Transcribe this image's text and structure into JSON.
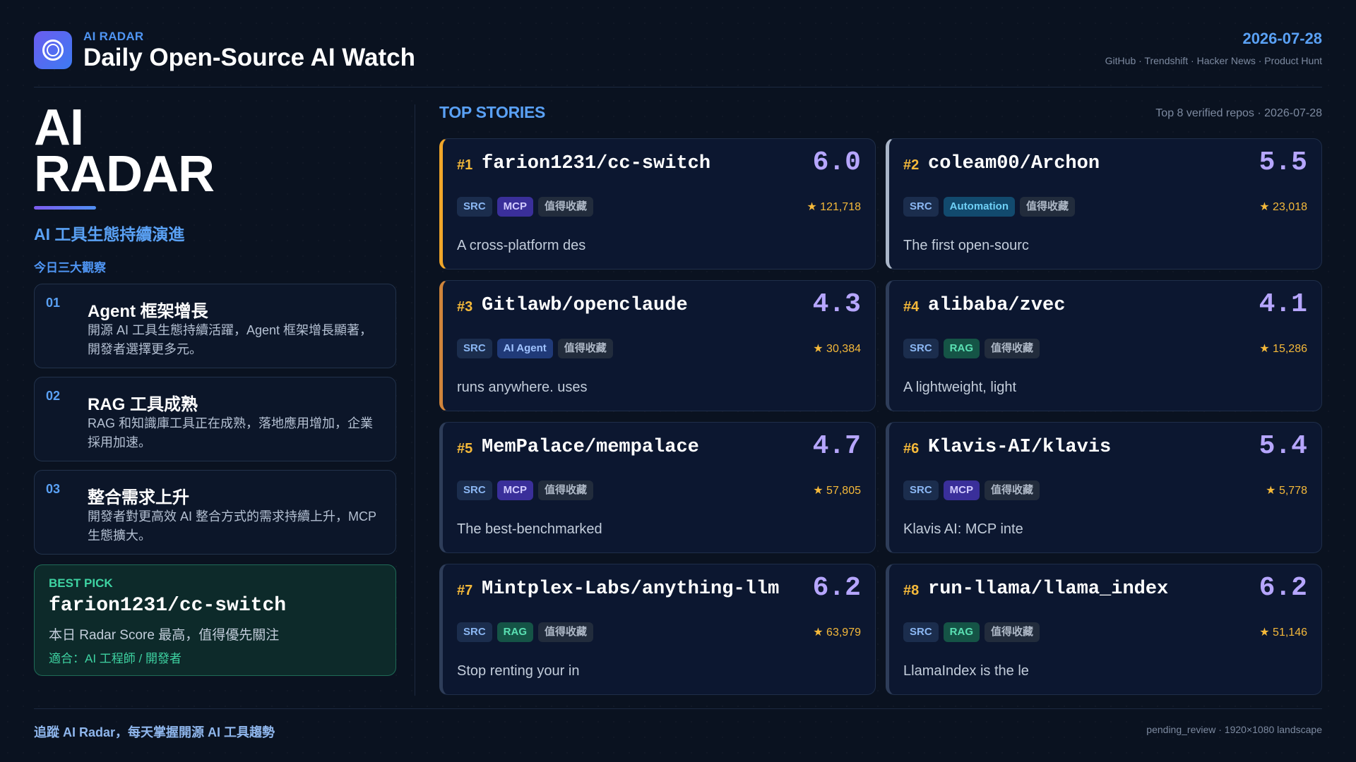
{
  "header": {
    "brand_small": "AI RADAR",
    "brand_title": "Daily Open-Source AI Watch",
    "date": "2026-07-28",
    "sources": "GitHub · Trendshift · Hacker News · Product Hunt",
    "logo_icon": "radar-icon"
  },
  "left": {
    "hero_line1": "AI",
    "hero_line2": "RADAR",
    "subtitle": "AI 工具生態持續演進",
    "insights_label": "今日三大觀察",
    "insights": [
      {
        "num": "01",
        "title": "Agent 框架增長",
        "body": "開源 AI 工具生態持續活躍，Agent 框架增長顯著，開發者選擇更多元。"
      },
      {
        "num": "02",
        "title": "RAG 工具成熟",
        "body": "RAG 和知識庫工具正在成熟，落地應用增加，企業採用加速。"
      },
      {
        "num": "03",
        "title": "整合需求上升",
        "body": "開發者對更高效 AI 整合方式的需求持續上升，MCP 生態擴大。"
      }
    ],
    "best_pick": {
      "label": "BEST PICK",
      "repo": "farion1231/cc-switch",
      "desc": "本日 Radar Score 最高，值得優先關注",
      "fit": "適合：AI 工程師 / 開發者"
    }
  },
  "stories": {
    "title": "TOP STORIES",
    "meta": "Top 8 verified repos · 2026-07-28",
    "items": [
      {
        "rank": "#1",
        "repo": "farion1231/cc-switch",
        "score": "6.0",
        "tags": [
          "SRC",
          "MCP",
          "值得收藏"
        ],
        "stars": "★ 121,718",
        "desc": "A cross-platform des"
      },
      {
        "rank": "#2",
        "repo": "coleam00/Archon",
        "score": "5.5",
        "tags": [
          "SRC",
          "Automation",
          "值得收藏"
        ],
        "stars": "★ 23,018",
        "desc": "The first open-sourc"
      },
      {
        "rank": "#3",
        "repo": "Gitlawb/openclaude",
        "score": "4.3",
        "tags": [
          "SRC",
          "AI Agent",
          "值得收藏"
        ],
        "stars": "★ 30,384",
        "desc": "runs anywhere. uses"
      },
      {
        "rank": "#4",
        "repo": "alibaba/zvec",
        "score": "4.1",
        "tags": [
          "SRC",
          "RAG",
          "值得收藏"
        ],
        "stars": "★ 15,286",
        "desc": "A lightweight, light"
      },
      {
        "rank": "#5",
        "repo": "MemPalace/mempalace",
        "score": "4.7",
        "tags": [
          "SRC",
          "MCP",
          "值得收藏"
        ],
        "stars": "★ 57,805",
        "desc": "The best-benchmarked"
      },
      {
        "rank": "#6",
        "repo": "Klavis-AI/klavis",
        "score": "5.4",
        "tags": [
          "SRC",
          "MCP",
          "值得收藏"
        ],
        "stars": "★ 5,778",
        "desc": "Klavis AI: MCP inte"
      },
      {
        "rank": "#7",
        "repo": "Mintplex-Labs/anything-llm",
        "score": "6.2",
        "tags": [
          "SRC",
          "RAG",
          "值得收藏"
        ],
        "stars": "★ 63,979",
        "desc": "Stop renting your in"
      },
      {
        "rank": "#8",
        "repo": "run-llama/llama_index",
        "score": "6.2",
        "tags": [
          "SRC",
          "RAG",
          "值得收藏"
        ],
        "stars": "★ 51,146",
        "desc": "LlamaIndex is the le"
      }
    ]
  },
  "footer": {
    "left": "追蹤 AI Radar，每天掌握開源 AI 工具趨勢",
    "right": "pending_review · 1920×1080 landscape"
  },
  "colors": {
    "background": "#0a1220",
    "accent_blue": "#5aa1f5",
    "score_purple": "#b6a6ff",
    "rank_gold": "#f5b93a",
    "best_green": "#3ed3a2"
  }
}
